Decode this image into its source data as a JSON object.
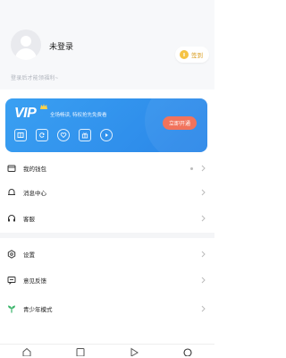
{
  "profile": {
    "login_title": "未登录",
    "login_hint": "登录后才能领福利~",
    "signin_label": "签到"
  },
  "vip": {
    "logo": "VIP",
    "desc": "全场畅读, 特权抢先免费看",
    "open_label": "立即开通",
    "icons": [
      "book-icon",
      "refresh-icon",
      "heart-icon",
      "gift-icon",
      "play-icon"
    ]
  },
  "menu": {
    "items": [
      {
        "label": "我的钱包",
        "icon": "wallet-icon"
      },
      {
        "label": "消息中心",
        "icon": "bell-icon"
      },
      {
        "label": "客服",
        "icon": "headset-icon"
      },
      {
        "label": "设置",
        "icon": "settings-icon"
      },
      {
        "label": "意见反馈",
        "icon": "feedback-icon"
      },
      {
        "label": "青少年模式",
        "icon": "sprout-icon"
      }
    ]
  },
  "tabbar": {
    "tabs": [
      "home-tab-icon",
      "bookshelf-tab-icon",
      "video-tab-icon",
      "profile-tab-icon"
    ]
  },
  "colors": {
    "vip_blue": "#3aa0f2",
    "open_button": "#f16b52",
    "coin": "#f5c343",
    "teen_green": "#3bb56a"
  }
}
